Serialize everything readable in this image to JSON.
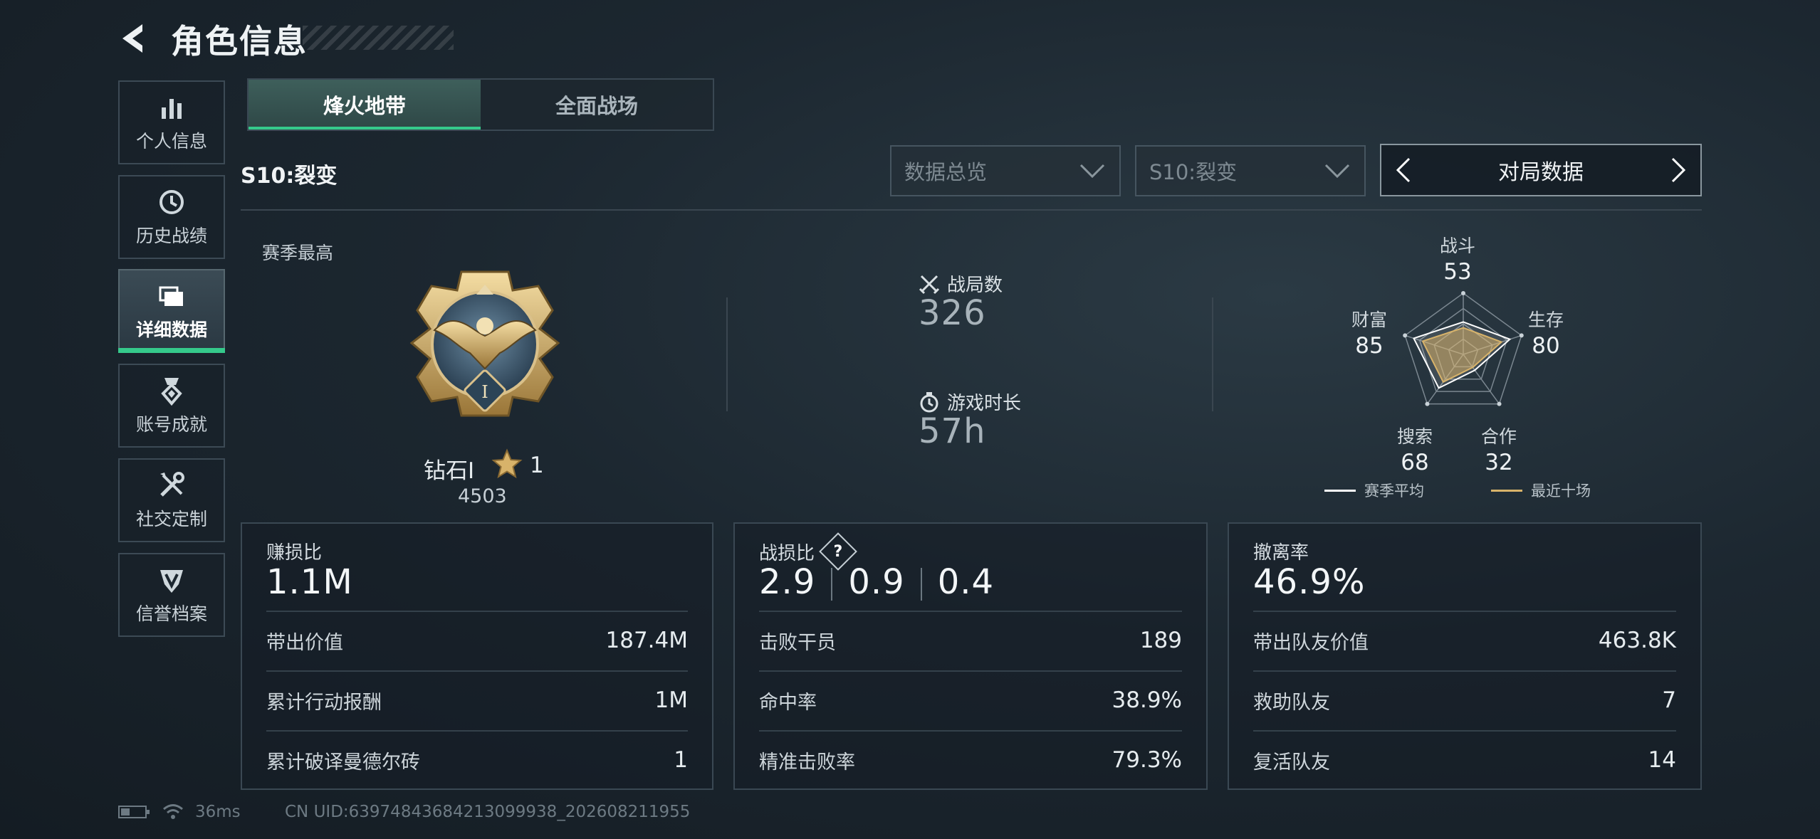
{
  "header": {
    "title": "角色信息"
  },
  "sidebar": {
    "items": [
      {
        "label": "个人信息",
        "icon": "bar-chart-icon"
      },
      {
        "label": "历史战绩",
        "icon": "history-clock-icon"
      },
      {
        "label": "详细数据",
        "icon": "folder-stack-icon",
        "active": true
      },
      {
        "label": "账号成就",
        "icon": "medal-icon"
      },
      {
        "label": "社交定制",
        "icon": "wrench-screwdriver-icon"
      },
      {
        "label": "信誉档案",
        "icon": "shield-badge-icon"
      }
    ]
  },
  "tabs": [
    {
      "label": "烽火地带",
      "active": true
    },
    {
      "label": "全面战场",
      "active": false
    }
  ],
  "season_label": "S10:裂变",
  "filters": {
    "overview": "数据总览",
    "season": "S10:裂变",
    "cycler": "对局数据"
  },
  "rank": {
    "section_label": "赛季最高",
    "name": "钻石I",
    "stars": "1",
    "points": "4503"
  },
  "metrics": {
    "matches_label": "战局数",
    "matches_value": "326",
    "playtime_label": "游戏时长",
    "playtime_value": "57h"
  },
  "radar": {
    "axes": [
      {
        "label": "战斗",
        "value": "53"
      },
      {
        "label": "生存",
        "value": "80"
      },
      {
        "label": "合作",
        "value": "32"
      },
      {
        "label": "搜索",
        "value": "68"
      },
      {
        "label": "财富",
        "value": "85"
      }
    ],
    "legend_avg": "赛季平均",
    "legend_recent": "最近十场",
    "avg_color": "#ffffff",
    "recent_color": "#d8b36a"
  },
  "cards": {
    "profit": {
      "title": "赚损比",
      "big": "1.1M",
      "rows": [
        {
          "k": "带出价值",
          "v": "187.4M"
        },
        {
          "k": "累计行动报酬",
          "v": "1M"
        },
        {
          "k": "累计破译曼德尔砖",
          "v": "1"
        }
      ]
    },
    "kd": {
      "title": "战损比",
      "help": "?",
      "values": [
        "2.9",
        "0.9",
        "0.4"
      ],
      "rows": [
        {
          "k": "击败干员",
          "v": "189"
        },
        {
          "k": "命中率",
          "v": "38.9%"
        },
        {
          "k": "精准击败率",
          "v": "79.3%"
        }
      ]
    },
    "extract": {
      "title": "撤离率",
      "big": "46.9%",
      "rows": [
        {
          "k": "带出队友价值",
          "v": "463.8K"
        },
        {
          "k": "救助队友",
          "v": "7"
        },
        {
          "k": "复活队友",
          "v": "14"
        }
      ]
    }
  },
  "status": {
    "ping": "36ms",
    "uid": "CN UID:63974843684213099938_202608211955"
  },
  "colors": {
    "accent": "#35c98b",
    "gold": "#d8b36a"
  }
}
